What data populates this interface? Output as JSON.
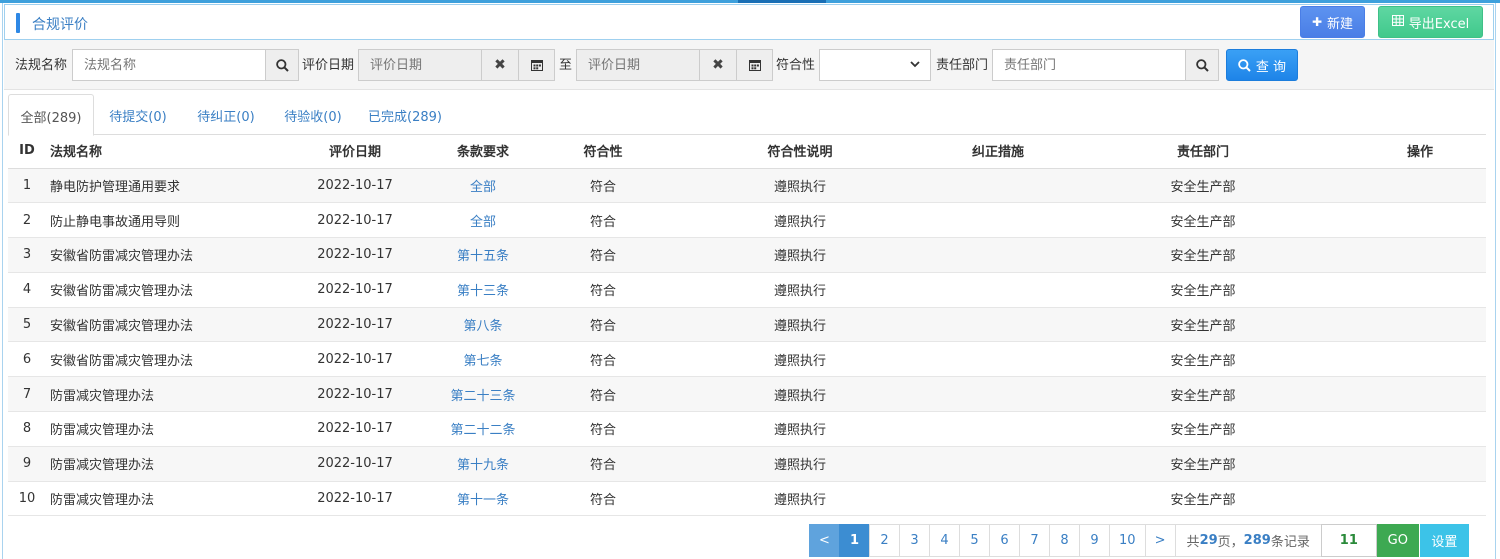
{
  "colors": {
    "accent": "#2e88e5",
    "link": "#3a7fc4",
    "new_btn": "#4a7ee6",
    "export_btn": "#41c98c",
    "query_btn": "#1e84e8",
    "go_btn": "#3da952",
    "set_btn": "#3cc3e8"
  },
  "header": {
    "title": "合规评价",
    "new_label": "新建",
    "export_label": "导出Excel",
    "new_icon": "plus-icon",
    "export_icon": "table-icon"
  },
  "filter": {
    "law_name_label": "法规名称",
    "law_name_placeholder": "法规名称",
    "date_label": "评价日期",
    "date_from_placeholder": "评价日期",
    "to_label": "至",
    "date_to_placeholder": "评价日期",
    "compliance_label": "符合性",
    "compliance_value": "",
    "dept_label": "责任部门",
    "dept_placeholder": "责任部门",
    "query_label": "查 询"
  },
  "tabs": [
    {
      "label": "全部(289)",
      "active": true
    },
    {
      "label": "待提交(0)"
    },
    {
      "label": "待纠正(0)"
    },
    {
      "label": "待验收(0)"
    },
    {
      "label": "已完成(289)"
    }
  ],
  "table": {
    "columns": [
      "ID",
      "法规名称",
      "评价日期",
      "条款要求",
      "符合性",
      "符合性说明",
      "纠正措施",
      "责任部门",
      "操作"
    ],
    "rows": [
      [
        "1",
        "静电防护管理通用要求",
        "2022-10-17",
        "全部",
        "符合",
        "遵照执行",
        "",
        "安全生产部",
        ""
      ],
      [
        "2",
        "防止静电事故通用导则",
        "2022-10-17",
        "全部",
        "符合",
        "遵照执行",
        "",
        "安全生产部",
        ""
      ],
      [
        "3",
        "安徽省防雷减灾管理办法",
        "2022-10-17",
        "第十五条",
        "符合",
        "遵照执行",
        "",
        "安全生产部",
        ""
      ],
      [
        "4",
        "安徽省防雷减灾管理办法",
        "2022-10-17",
        "第十三条",
        "符合",
        "遵照执行",
        "",
        "安全生产部",
        ""
      ],
      [
        "5",
        "安徽省防雷减灾管理办法",
        "2022-10-17",
        "第八条",
        "符合",
        "遵照执行",
        "",
        "安全生产部",
        ""
      ],
      [
        "6",
        "安徽省防雷减灾管理办法",
        "2022-10-17",
        "第七条",
        "符合",
        "遵照执行",
        "",
        "安全生产部",
        ""
      ],
      [
        "7",
        "防雷减灾管理办法",
        "2022-10-17",
        "第二十三条",
        "符合",
        "遵照执行",
        "",
        "安全生产部",
        ""
      ],
      [
        "8",
        "防雷减灾管理办法",
        "2022-10-17",
        "第二十二条",
        "符合",
        "遵照执行",
        "",
        "安全生产部",
        ""
      ],
      [
        "9",
        "防雷减灾管理办法",
        "2022-10-17",
        "第十九条",
        "符合",
        "遵照执行",
        "",
        "安全生产部",
        ""
      ],
      [
        "10",
        "防雷减灾管理办法",
        "2022-10-17",
        "第十一条",
        "符合",
        "遵照执行",
        "",
        "安全生产部",
        ""
      ]
    ]
  },
  "pager": {
    "prev": "<",
    "pages": [
      "1",
      "2",
      "3",
      "4",
      "5",
      "6",
      "7",
      "8",
      "9",
      "10"
    ],
    "current": "1",
    "next": ">",
    "info_prefix": "共",
    "total_pages": "29",
    "info_mid": "页，",
    "total_records": "289",
    "info_suffix": "条记录",
    "go_value": "11",
    "go_label": "GO",
    "settings_label": "设置"
  }
}
